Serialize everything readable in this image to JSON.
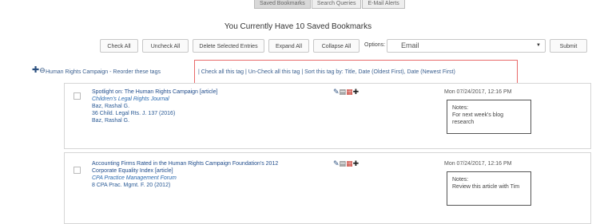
{
  "tabs": [
    "Saved Bookmarks",
    "Search Queries",
    "E-Mail Alerts"
  ],
  "headline": "You Currently Have 10 Saved Bookmarks",
  "toolbar": {
    "check_all": "Check All",
    "uncheck_all": "Uncheck All",
    "delete_selected": "Delete Selected Entries",
    "expand_all": "Expand All",
    "collapse_all": "Collapse All",
    "options_label": "Options:",
    "options_value": "Email",
    "submit": "Submit"
  },
  "tag": {
    "name": "Human Rights Campaign",
    "reorder": "- Reorder these tags",
    "check_all": "Check all this tag",
    "uncheck_all": "Un-Check all this tag",
    "sort_label": "Sort this tag by:",
    "sort_title": "Title",
    "sort_oldest": "Date (Oldest First)",
    "sort_newest": "Date (Newest First)"
  },
  "entries": [
    {
      "title": "Spotlight on: The Human Rights Campaign [article]",
      "journal": "Children's Legal Rights Journal",
      "author": "Baz, Rashal G.",
      "citation": "36 Child. Legal Rts. J. 137 (2016)",
      "author2": "Baz, Rashal G.",
      "date": "Mon 07/24/2017, 12:16 PM",
      "notes_label": "Notes:",
      "notes_text": "For next week's blog research"
    },
    {
      "title": "Accounting Firms Rated in the Human Rights Campaign Foundation's 2012",
      "title2": "Corporate Equality Index [article]",
      "journal": "CPA Practice Management Forum",
      "citation": "8 CPA Prac. Mgmt. F. 20 (2012)",
      "date": "Mon 07/24/2017, 12:16 PM",
      "notes_label": "Notes:",
      "notes_text": "Review this article with Tim"
    }
  ],
  "icons": {
    "expand": "plus-icon",
    "collapse": "minus-circle-icon",
    "edit": "edit-icon",
    "copy": "copy-icon",
    "pdf": "pdf-icon",
    "add": "add-icon"
  },
  "colors": {
    "link": "#3a5f8f",
    "highlight": "#e86a6a"
  }
}
